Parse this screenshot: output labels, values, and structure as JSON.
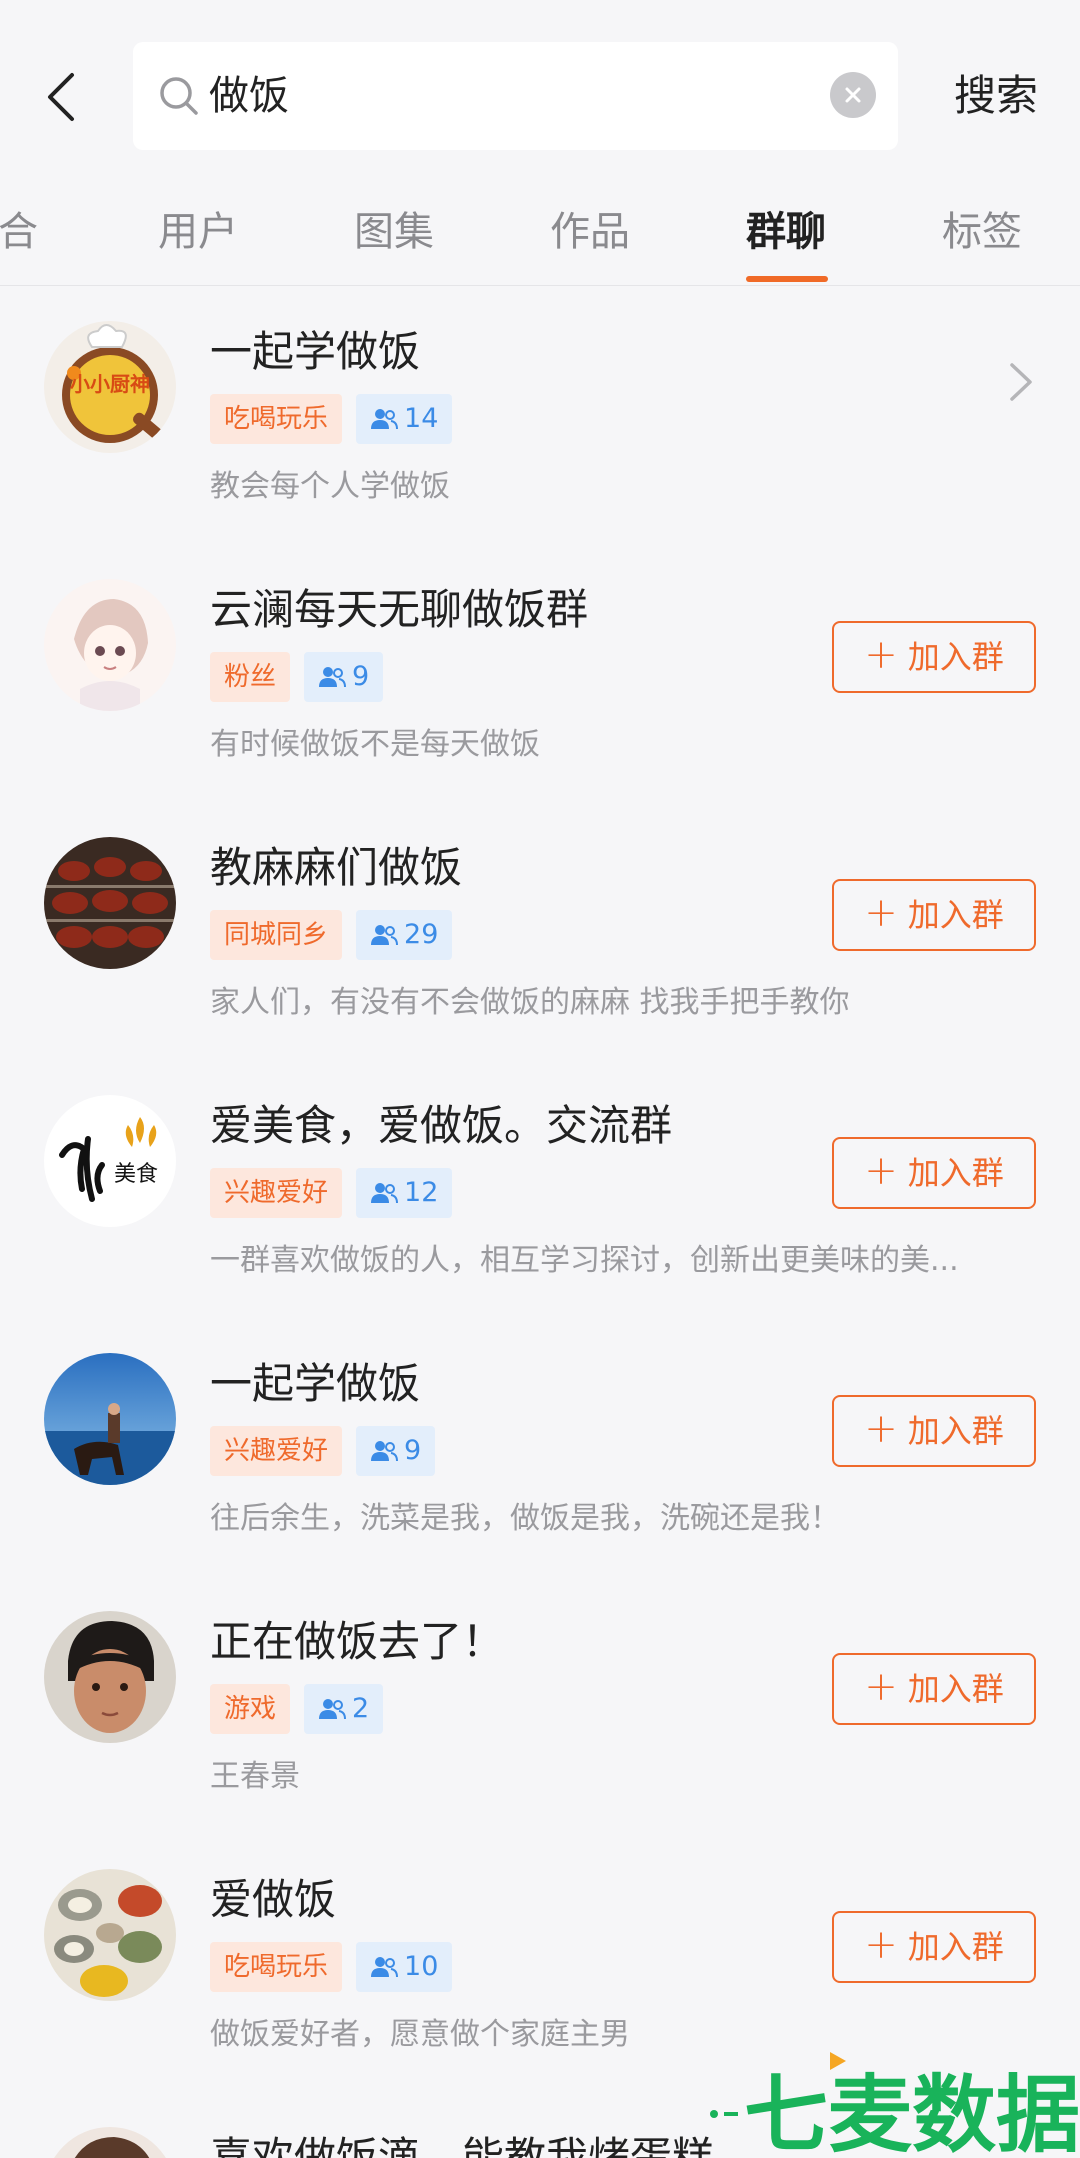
{
  "search": {
    "query": "做饭",
    "button_label": "搜索"
  },
  "tabs": [
    {
      "label": "综合",
      "shown": "合"
    },
    {
      "label": "用户",
      "shown": "用户"
    },
    {
      "label": "图集",
      "shown": "图集"
    },
    {
      "label": "作品",
      "shown": "作品"
    },
    {
      "label": "群聊",
      "shown": "群聊",
      "active": true
    },
    {
      "label": "标签",
      "shown": "标签"
    }
  ],
  "join_label": "加入群",
  "groups": [
    {
      "title": "一起学做饭",
      "category": "吃喝玩乐",
      "members": "14",
      "desc": "教会每个人学做饭",
      "action": "chevron",
      "avatar_text": "小小厨神"
    },
    {
      "title": "云澜每天无聊做饭群",
      "category": "粉丝",
      "members": "9",
      "desc": "有时候做饭不是每天做饭",
      "action": "join"
    },
    {
      "title": "教麻麻们做饭",
      "category": "同城同乡",
      "members": "29",
      "desc": "家人们，有没有不会做饭的麻麻  找我手把手教你",
      "action": "join"
    },
    {
      "title": "爱美食，爱做饭。交流群",
      "category": "兴趣爱好",
      "members": "12",
      "desc": "一群喜欢做饭的人，相互学习探讨，创新出更美味的美...",
      "action": "join",
      "avatar_text": "美食"
    },
    {
      "title": "一起学做饭",
      "category": "兴趣爱好",
      "members": "9",
      "desc": "往后余生，洗菜是我，做饭是我，洗碗还是我！",
      "action": "join"
    },
    {
      "title": "正在做饭去了！",
      "category": "游戏",
      "members": "2",
      "desc": "王春景",
      "action": "join"
    },
    {
      "title": "爱做饭",
      "category": "吃喝玩乐",
      "members": "10",
      "desc": "做饭爱好者，愿意做个家庭主男",
      "action": "join"
    },
    {
      "title": "喜欢做饭滴，能教我烤蛋糕",
      "category": "",
      "members": "",
      "desc": "",
      "action": "join"
    }
  ],
  "watermark": {
    "text": "七麦数据"
  },
  "colors": {
    "accent": "#ef6a2c",
    "blue": "#3b8be6",
    "background": "#f6f6f8"
  }
}
